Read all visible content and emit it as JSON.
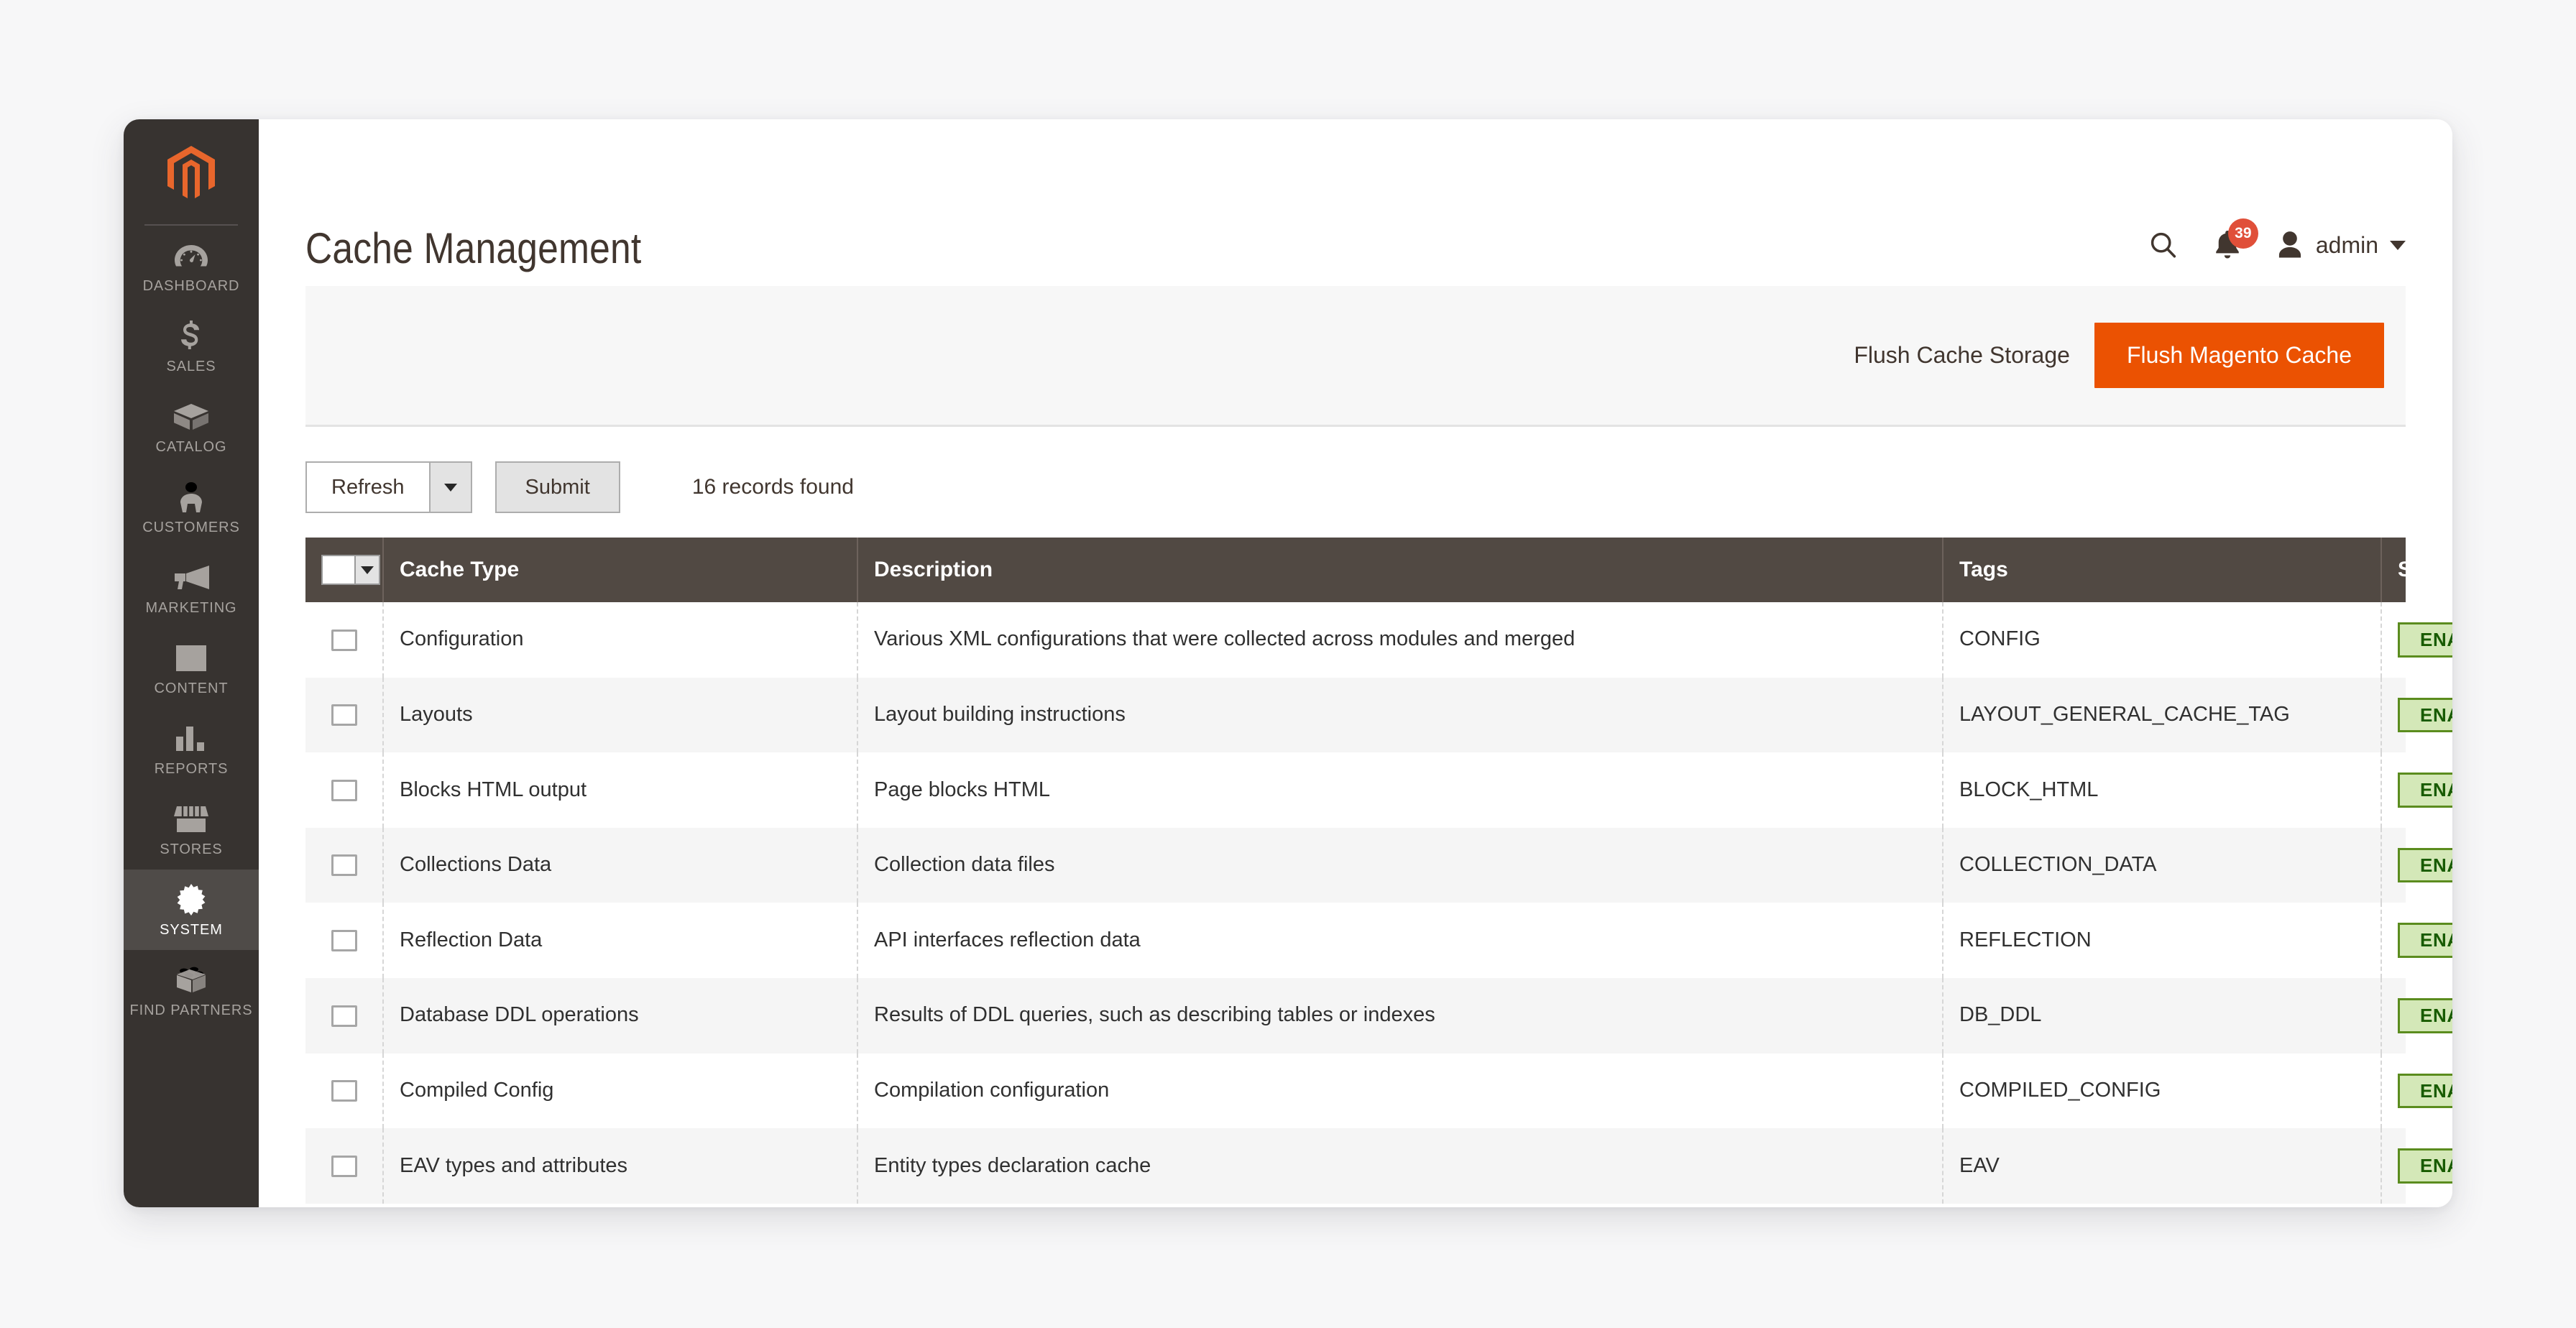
{
  "sidebar": {
    "logo_name": "magento-logo",
    "items": [
      {
        "label": "DASHBOARD",
        "icon": "dashboard-gauge-icon",
        "active": false
      },
      {
        "label": "SALES",
        "icon": "dollar-sign-icon",
        "active": false
      },
      {
        "label": "CATALOG",
        "icon": "box-icon",
        "active": false
      },
      {
        "label": "CUSTOMERS",
        "icon": "person-icon",
        "active": false
      },
      {
        "label": "MARKETING",
        "icon": "megaphone-icon",
        "active": false
      },
      {
        "label": "CONTENT",
        "icon": "layout-panels-icon",
        "active": false
      },
      {
        "label": "REPORTS",
        "icon": "bar-chart-icon",
        "active": false
      },
      {
        "label": "STORES",
        "icon": "storefront-icon",
        "active": false
      },
      {
        "label": "SYSTEM",
        "icon": "gear-icon",
        "active": true
      },
      {
        "label": "FIND PARTNERS",
        "icon": "lego-brick-icon",
        "active": false
      }
    ]
  },
  "header": {
    "title": "Cache Management",
    "search_icon": "search-icon",
    "notifications_icon": "bell-icon",
    "notifications_count": "39",
    "avatar_icon": "user-avatar-icon",
    "user_name": "admin",
    "user_caret_icon": "chevron-down-icon"
  },
  "actions": {
    "flush_cache_storage": "Flush Cache Storage",
    "flush_magento_cache": "Flush Magento Cache",
    "accent_color": "#eb5202"
  },
  "toolbar": {
    "mass_action_label": "Refresh",
    "mass_action_caret_icon": "chevron-down-icon",
    "submit_label": "Submit",
    "records_found": "16 records found"
  },
  "grid": {
    "columns": [
      "Cache Type",
      "Description",
      "Tags",
      "Status"
    ],
    "select_all_icon": "select-all-dropdown-icon",
    "rows": [
      {
        "checked": false,
        "cache_type": "Configuration",
        "description": "Various XML configurations that were collected across modules and merged",
        "tags": "CONFIG",
        "status": "ENABLED"
      },
      {
        "checked": false,
        "cache_type": "Layouts",
        "description": "Layout building instructions",
        "tags": "LAYOUT_GENERAL_CACHE_TAG",
        "status": "ENABLED"
      },
      {
        "checked": false,
        "cache_type": "Blocks HTML output",
        "description": "Page blocks HTML",
        "tags": "BLOCK_HTML",
        "status": "ENABLED"
      },
      {
        "checked": false,
        "cache_type": "Collections Data",
        "description": "Collection data files",
        "tags": "COLLECTION_DATA",
        "status": "ENABLED"
      },
      {
        "checked": false,
        "cache_type": "Reflection Data",
        "description": "API interfaces reflection data",
        "tags": "REFLECTION",
        "status": "ENABLED"
      },
      {
        "checked": false,
        "cache_type": "Database DDL operations",
        "description": "Results of DDL queries, such as describing tables or indexes",
        "tags": "DB_DDL",
        "status": "ENABLED"
      },
      {
        "checked": false,
        "cache_type": "Compiled Config",
        "description": "Compilation configuration",
        "tags": "COMPILED_CONFIG",
        "status": "ENABLED"
      },
      {
        "checked": false,
        "cache_type": "EAV types and attributes",
        "description": "Entity types declaration cache",
        "tags": "EAV",
        "status": "ENABLED"
      }
    ]
  }
}
